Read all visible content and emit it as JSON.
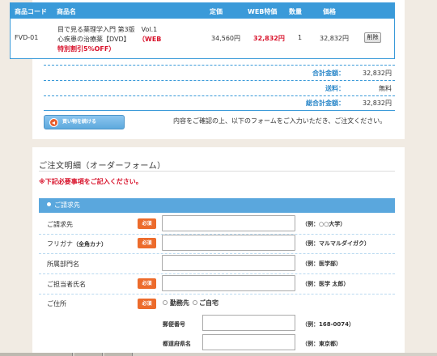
{
  "cart": {
    "headers": {
      "code": "商品コード",
      "name": "商品名",
      "price": "定価",
      "web_price": "WEB特価",
      "qty": "数量",
      "total": "価格"
    },
    "item": {
      "code": "FVD-01",
      "name_line1": "目で見る薬理学入門 第3版　Vol.1",
      "name_line2": "心疾患の治療薬【DVD】",
      "web_tag": "（WEB",
      "web_tag2": "特別割引5%OFF）",
      "price": "34,560円",
      "web_price": "32,832円",
      "qty": "1",
      "total": "32,832円",
      "delete_label": "削除"
    },
    "summary": {
      "subtotal_label": "合計金額：",
      "subtotal_value": "32,832円",
      "shipping_label": "送料：",
      "shipping_value": "無料",
      "grand_label": "総合計金額：",
      "grand_value": "32,832円"
    },
    "continue_label": "買い物を続ける",
    "note": "内容をご確認の上、以下のフォームをご入力いただき、ご注文ください。"
  },
  "form": {
    "title": "ご注文明細（オーダーフォーム）",
    "required_note": "※下記必要事項をご記入ください。",
    "section_label": "ご請求先",
    "required_badge": "必須",
    "fields": {
      "billing": {
        "label": "ご請求先",
        "example": "（例：○○大学）"
      },
      "furigana": {
        "label": "フリガナ",
        "label_sub": "（全角カナ）",
        "example": "（例：マルマルダイガク）"
      },
      "department": {
        "label": "所属部門名",
        "example": "（例：医学部）"
      },
      "contact": {
        "label": "ご担当者氏名",
        "example": "（例：医学 太郎）"
      },
      "address": {
        "label": "ご住所",
        "radio_work": "勤務先",
        "radio_home": "ご自宅"
      },
      "postal": {
        "label": "郵便番号",
        "example": "（例：168-0074）"
      },
      "prefecture": {
        "label": "都道府県名",
        "example": "（例：東京都）"
      }
    }
  }
}
